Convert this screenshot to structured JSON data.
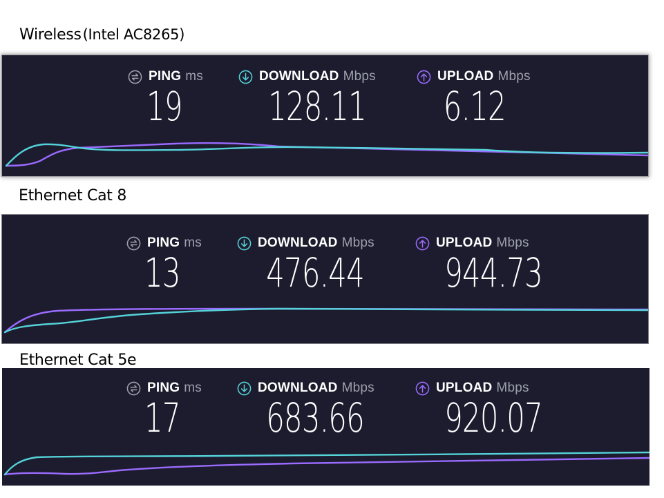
{
  "tests": [
    {
      "caption": "Wireless",
      "caption_paren": "(Intel AC8265)",
      "ping": {
        "label": "PING",
        "unit": "ms",
        "value": "19"
      },
      "download": {
        "label": "DOWNLOAD",
        "unit": "Mbps",
        "value": "128.11"
      },
      "upload": {
        "label": "UPLOAD",
        "unit": "Mbps",
        "value": "6.12"
      }
    },
    {
      "caption": "Ethernet Cat 8",
      "caption_paren": "",
      "ping": {
        "label": "PING",
        "unit": "ms",
        "value": "13"
      },
      "download": {
        "label": "DOWNLOAD",
        "unit": "Mbps",
        "value": "476.44"
      },
      "upload": {
        "label": "UPLOAD",
        "unit": "Mbps",
        "value": "944.73"
      }
    },
    {
      "caption": "Ethernet Cat 5e",
      "caption_paren": "",
      "ping": {
        "label": "PING",
        "unit": "ms",
        "value": "17"
      },
      "download": {
        "label": "DOWNLOAD",
        "unit": "Mbps",
        "value": "683.66"
      },
      "upload": {
        "label": "UPLOAD",
        "unit": "Mbps",
        "value": "920.07"
      }
    }
  ],
  "colors": {
    "panel_bg": "#1c1c2e",
    "download_accent": "#55d3d9",
    "upload_accent": "#9b6bff",
    "ping_icon": "#9ea0ad",
    "unit_text": "#9ea0ad"
  },
  "icons": {
    "ping": "ping-icon",
    "download": "download-arrow-icon",
    "upload": "upload-arrow-icon"
  }
}
